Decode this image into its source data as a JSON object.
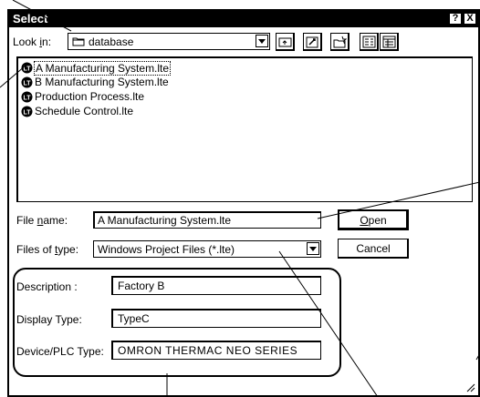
{
  "dialog": {
    "title": "Select",
    "help_button": "?",
    "close_button": "X"
  },
  "look_in": {
    "label_pre": "Look ",
    "label_accel": "i",
    "label_post": "n:",
    "value": "database",
    "icon": "folder-icon"
  },
  "toolbar": {
    "buttons": [
      "up-folder-icon",
      "new-folder-icon",
      "edit-icon",
      "list-view-icon",
      "details-view-icon"
    ]
  },
  "files": [
    {
      "name": "A Manufacturing System.lte",
      "selected": true
    },
    {
      "name": "B Manufacturing System.lte",
      "selected": false
    },
    {
      "name": "Production Process.lte",
      "selected": false
    },
    {
      "name": "Schedule Control.lte",
      "selected": false
    }
  ],
  "file_icon": "lt-file-icon",
  "file_name": {
    "label_pre": "File ",
    "label_accel": "n",
    "label_post": "ame:",
    "value": "A Manufacturing System.lte"
  },
  "file_type": {
    "label_pre": "Files of ",
    "label_accel": "t",
    "label_post": "ype:",
    "value": "Windows Project Files (*.lte)"
  },
  "buttons": {
    "open_accel": "O",
    "open_rest": "pen",
    "cancel": "Cancel"
  },
  "info": {
    "description_label": "Description :",
    "description_value": "Factory B",
    "display_type_label": "Display Type:",
    "display_type_value": "TypeC",
    "device_label": "Device/PLC Type:",
    "device_value": "OMRON THERMAC NEO SERIES"
  }
}
